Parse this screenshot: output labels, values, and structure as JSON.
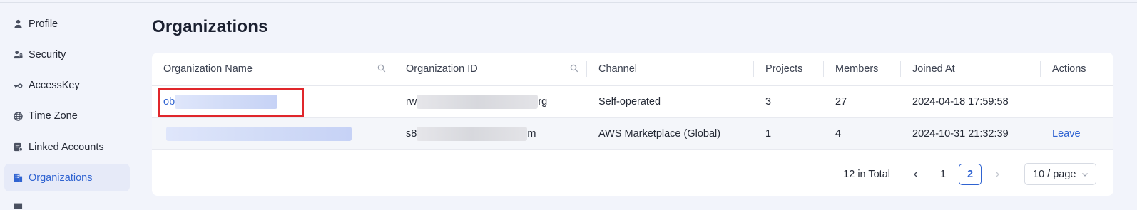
{
  "sidebar": {
    "items": [
      {
        "label": "Profile",
        "icon": "user-icon",
        "active": false
      },
      {
        "label": "Security",
        "icon": "security-user-icon",
        "active": false
      },
      {
        "label": "AccessKey",
        "icon": "key-icon",
        "active": false
      },
      {
        "label": "Time Zone",
        "icon": "globe-icon",
        "active": false
      },
      {
        "label": "Linked Accounts",
        "icon": "linked-accounts-icon",
        "active": false
      },
      {
        "label": "Organizations",
        "icon": "building-icon",
        "active": true
      }
    ]
  },
  "page": {
    "title": "Organizations"
  },
  "table": {
    "headers": [
      "Organization Name",
      "Organization ID",
      "Channel",
      "Projects",
      "Members",
      "Joined At",
      "Actions"
    ],
    "rows": [
      {
        "name_prefix": "ob",
        "id_prefix": "rw",
        "id_suffix": "rg",
        "channel": "Self-operated",
        "projects": "3",
        "members": "27",
        "joined": "2024-04-18 17:59:58",
        "action": ""
      },
      {
        "name_prefix": "",
        "id_prefix": "s8",
        "id_suffix": "m",
        "channel": "AWS Marketplace (Global)",
        "projects": "1",
        "members": "4",
        "joined": "2024-10-31 21:32:39",
        "action": "Leave"
      }
    ]
  },
  "pagination": {
    "total_text": "12 in Total",
    "prev": "<",
    "pages": [
      "1",
      "2"
    ],
    "current": "2",
    "next": ">",
    "page_size": "10 / page"
  },
  "colors": {
    "accent": "#2f63d1",
    "highlight": "#e0262b"
  }
}
